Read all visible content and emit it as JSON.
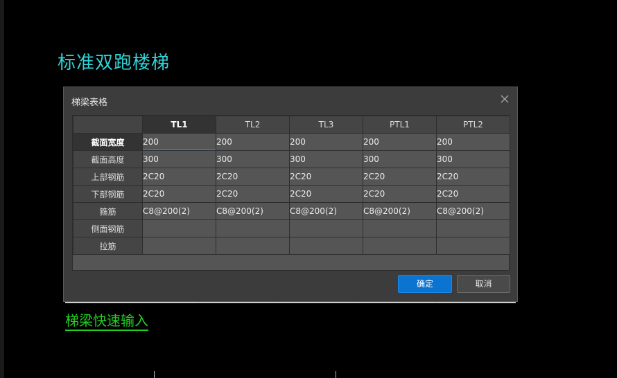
{
  "drawing": {
    "title": "标准双跑楼梯",
    "link_text": "梯梁快速输入"
  },
  "dialog": {
    "title": "梯梁表格",
    "ok_label": "确定",
    "cancel_label": "取消"
  },
  "grid": {
    "columns": [
      "TL1",
      "TL2",
      "TL3",
      "PTL1",
      "PTL2"
    ],
    "rows": [
      {
        "label": "截面宽度",
        "values": [
          "200",
          "200",
          "200",
          "200",
          "200"
        ]
      },
      {
        "label": "截面高度",
        "values": [
          "300",
          "300",
          "300",
          "300",
          "300"
        ]
      },
      {
        "label": "上部钢筋",
        "values": [
          "2C20",
          "2C20",
          "2C20",
          "2C20",
          "2C20"
        ]
      },
      {
        "label": "下部钢筋",
        "values": [
          "2C20",
          "2C20",
          "2C20",
          "2C20",
          "2C20"
        ]
      },
      {
        "label": "箍筋",
        "values": [
          "C8@200(2)",
          "C8@200(2)",
          "C8@200(2)",
          "C8@200(2)",
          "C8@200(2)"
        ]
      },
      {
        "label": "侧面钢筋",
        "values": [
          "",
          "",
          "",
          "",
          ""
        ]
      },
      {
        "label": "拉筋",
        "values": [
          "",
          "",
          "",
          "",
          ""
        ]
      }
    ]
  },
  "colors": {
    "title_cyan": "#2fd4d8",
    "link_green": "#22d022",
    "accent_blue": "#0b74d1"
  }
}
